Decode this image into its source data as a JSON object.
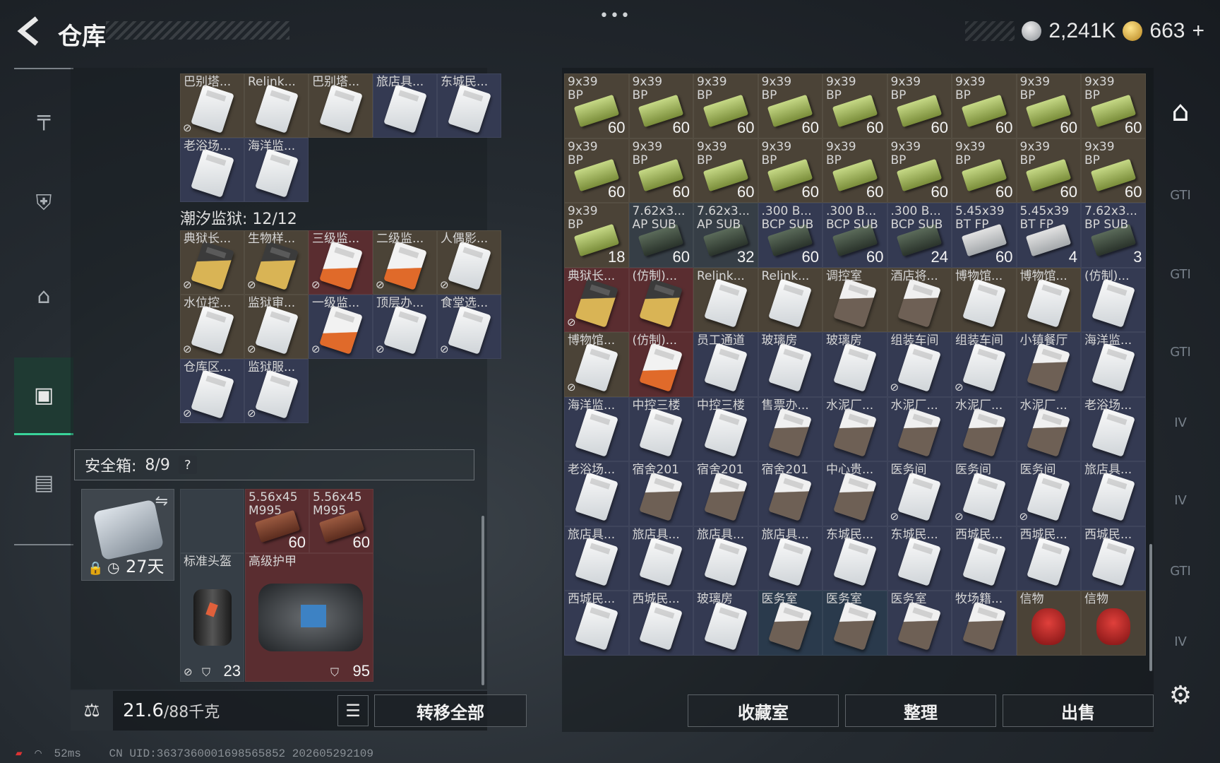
{
  "header": {
    "title": "仓库",
    "silver": "2,241K",
    "gold": "663",
    "plus": "+"
  },
  "left_nav": [
    "weapon-icon",
    "armor-icon",
    "backpack-icon",
    "container-icon",
    "toolbox-icon"
  ],
  "pouch_grid_top": [
    {
      "name": "巴别塔...",
      "color": "brown",
      "card": "white",
      "locked": true
    },
    {
      "name": "Relink...",
      "color": "brown",
      "card": "white",
      "locked": false
    },
    {
      "name": "巴别塔...",
      "color": "brown",
      "card": "white",
      "locked": false
    },
    {
      "name": "旅店具...",
      "color": "navy",
      "card": "white",
      "locked": false
    },
    {
      "name": "东城民...",
      "color": "navy",
      "card": "white",
      "locked": false
    },
    {
      "name": "老浴场...",
      "color": "navy",
      "card": "white",
      "locked": false
    },
    {
      "name": "海洋监...",
      "color": "navy",
      "card": "white",
      "locked": false
    }
  ],
  "prison_label": "潮汐监狱: 12/12",
  "prison_grid": [
    {
      "name": "典狱长...",
      "color": "brown",
      "card": "gold",
      "locked": true
    },
    {
      "name": "生物样...",
      "color": "brown",
      "card": "gold",
      "locked": true
    },
    {
      "name": "三级监...",
      "color": "red",
      "card": "orange",
      "locked": true
    },
    {
      "name": "二级监...",
      "color": "brown",
      "card": "orange",
      "locked": true
    },
    {
      "name": "人偶影...",
      "color": "brown",
      "card": "white",
      "locked": true
    },
    {
      "name": "水位控...",
      "color": "brown",
      "card": "white",
      "locked": true
    },
    {
      "name": "监狱审...",
      "color": "brown",
      "card": "white",
      "locked": true
    },
    {
      "name": "一级监...",
      "color": "navy",
      "card": "orange",
      "locked": true
    },
    {
      "name": "顶层办...",
      "color": "navy",
      "card": "white",
      "locked": true
    },
    {
      "name": "食堂选...",
      "color": "navy",
      "card": "white",
      "locked": true
    },
    {
      "name": "仓库区...",
      "color": "navy",
      "card": "white",
      "locked": true
    },
    {
      "name": "监狱服...",
      "color": "navy",
      "card": "white",
      "locked": true
    }
  ],
  "safe_box": {
    "label": "安全箱:",
    "count": "8/9",
    "help": "?",
    "days": "27天"
  },
  "safe_items": [
    {
      "name": "5.56x45\nM995",
      "count": "60"
    },
    {
      "name": "5.56x45\nM995",
      "count": "60"
    }
  ],
  "helmet": {
    "name": "标准头盔",
    "durability": "23"
  },
  "armor": {
    "name": "高级护甲",
    "durability": "95"
  },
  "weight": {
    "value": "21.6",
    "max": "/88千克"
  },
  "buttons": {
    "transfer_all": "转移全部",
    "collection": "收藏室",
    "organize": "整理",
    "sell": "出售"
  },
  "stash": [
    {
      "name": "9x39\nBP",
      "count": "60",
      "color": "brown",
      "type": "ammo"
    },
    {
      "name": "9x39\nBP",
      "count": "60",
      "color": "brown",
      "type": "ammo"
    },
    {
      "name": "9x39\nBP",
      "count": "60",
      "color": "brown",
      "type": "ammo"
    },
    {
      "name": "9x39\nBP",
      "count": "60",
      "color": "brown",
      "type": "ammo"
    },
    {
      "name": "9x39\nBP",
      "count": "60",
      "color": "brown",
      "type": "ammo"
    },
    {
      "name": "9x39\nBP",
      "count": "60",
      "color": "brown",
      "type": "ammo"
    },
    {
      "name": "9x39\nBP",
      "count": "60",
      "color": "brown",
      "type": "ammo"
    },
    {
      "name": "9x39\nBP",
      "count": "60",
      "color": "brown",
      "type": "ammo"
    },
    {
      "name": "9x39\nBP",
      "count": "60",
      "color": "brown",
      "type": "ammo"
    },
    {
      "name": "9x39\nBP",
      "count": "60",
      "color": "brown",
      "type": "ammo"
    },
    {
      "name": "9x39\nBP",
      "count": "60",
      "color": "brown",
      "type": "ammo"
    },
    {
      "name": "9x39\nBP",
      "count": "60",
      "color": "brown",
      "type": "ammo"
    },
    {
      "name": "9x39\nBP",
      "count": "60",
      "color": "brown",
      "type": "ammo"
    },
    {
      "name": "9x39\nBP",
      "count": "60",
      "color": "brown",
      "type": "ammo"
    },
    {
      "name": "9x39\nBP",
      "count": "60",
      "color": "brown",
      "type": "ammo"
    },
    {
      "name": "9x39\nBP",
      "count": "60",
      "color": "brown",
      "type": "ammo"
    },
    {
      "name": "9x39\nBP",
      "count": "60",
      "color": "brown",
      "type": "ammo"
    },
    {
      "name": "9x39\nBP",
      "count": "60",
      "color": "brown",
      "type": "ammo"
    },
    {
      "name": "9x39\nBP",
      "count": "18",
      "color": "brown",
      "type": "ammo"
    },
    {
      "name": "7.62x3...\nAP SUB",
      "count": "60",
      "color": "dark",
      "type": "ammo2"
    },
    {
      "name": "7.62x3...\nAP SUB",
      "count": "32",
      "color": "dark",
      "type": "ammo2"
    },
    {
      "name": ".300 B...\nBCP SUB",
      "count": "60",
      "color": "navy",
      "type": "ammo2"
    },
    {
      "name": ".300 B...\nBCP SUB",
      "count": "60",
      "color": "navy",
      "type": "ammo2"
    },
    {
      "name": ".300 B...\nBCP SUB",
      "count": "24",
      "color": "navy",
      "type": "ammo2"
    },
    {
      "name": "5.45x39\nBT FP",
      "count": "60",
      "color": "navy",
      "type": "ammo3"
    },
    {
      "name": "5.45x39\nBT FP",
      "count": "4",
      "color": "navy",
      "type": "ammo3"
    },
    {
      "name": "7.62x3...\nBP SUB",
      "count": "3",
      "color": "navy",
      "type": "ammo2"
    },
    {
      "name": "典狱长...",
      "count": "",
      "color": "red",
      "type": "card-gold",
      "locked": true
    },
    {
      "name": "(仿制)...",
      "count": "",
      "color": "red",
      "type": "card-gold"
    },
    {
      "name": "Relink...",
      "count": "",
      "color": "brown",
      "type": "card"
    },
    {
      "name": "Relink...",
      "count": "",
      "color": "brown",
      "type": "card"
    },
    {
      "name": "调控室",
      "count": "",
      "color": "brown",
      "type": "card-dirty"
    },
    {
      "name": "酒店将...",
      "count": "",
      "color": "brown",
      "type": "card-dirty"
    },
    {
      "name": "博物馆...",
      "count": "",
      "color": "brown",
      "type": "card"
    },
    {
      "name": "博物馆...",
      "count": "",
      "color": "brown",
      "type": "card"
    },
    {
      "name": "(仿制)...",
      "count": "",
      "color": "navy",
      "type": "card"
    },
    {
      "name": "博物馆...",
      "count": "",
      "color": "brown",
      "type": "card",
      "locked": true
    },
    {
      "name": "(仿制)...",
      "count": "",
      "color": "red",
      "type": "card-orange"
    },
    {
      "name": "员工通道",
      "count": "",
      "color": "navy",
      "type": "card"
    },
    {
      "name": "玻璃房",
      "count": "",
      "color": "navy",
      "type": "card"
    },
    {
      "name": "玻璃房",
      "count": "",
      "color": "navy",
      "type": "card"
    },
    {
      "name": "组装车间",
      "count": "",
      "color": "navy",
      "type": "card",
      "locked": true
    },
    {
      "name": "组装车间",
      "count": "",
      "color": "navy",
      "type": "card",
      "locked": true
    },
    {
      "name": "小镇餐厅",
      "count": "",
      "color": "navy",
      "type": "card-dirty"
    },
    {
      "name": "海洋监...",
      "count": "",
      "color": "navy",
      "type": "card"
    },
    {
      "name": "海洋监...",
      "count": "",
      "color": "navy",
      "type": "card"
    },
    {
      "name": "中控三楼",
      "count": "",
      "color": "navy",
      "type": "card"
    },
    {
      "name": "中控三楼",
      "count": "",
      "color": "navy",
      "type": "card"
    },
    {
      "name": "售票办...",
      "count": "",
      "color": "navy",
      "type": "card-dirty"
    },
    {
      "name": "水泥厂...",
      "count": "",
      "color": "navy",
      "type": "card-dirty"
    },
    {
      "name": "水泥厂...",
      "count": "",
      "color": "navy",
      "type": "card-dirty"
    },
    {
      "name": "水泥厂...",
      "count": "",
      "color": "navy",
      "type": "card-dirty"
    },
    {
      "name": "水泥厂...",
      "count": "",
      "color": "navy",
      "type": "card-dirty"
    },
    {
      "name": "老浴场...",
      "count": "",
      "color": "navy",
      "type": "card"
    },
    {
      "name": "老浴场...",
      "count": "",
      "color": "navy",
      "type": "card"
    },
    {
      "name": "宿舍201",
      "count": "",
      "color": "navy",
      "type": "card-dirty"
    },
    {
      "name": "宿舍201",
      "count": "",
      "color": "navy",
      "type": "card-dirty"
    },
    {
      "name": "宿舍201",
      "count": "",
      "color": "navy",
      "type": "card-dirty"
    },
    {
      "name": "中心贵...",
      "count": "",
      "color": "navy",
      "type": "card-dirty"
    },
    {
      "name": "医务间",
      "count": "",
      "color": "navy",
      "type": "card",
      "locked": true
    },
    {
      "name": "医务间",
      "count": "",
      "color": "navy",
      "type": "card",
      "locked": true
    },
    {
      "name": "医务间",
      "count": "",
      "color": "navy",
      "type": "card",
      "locked": true
    },
    {
      "name": "旅店具...",
      "count": "",
      "color": "navy",
      "type": "card"
    },
    {
      "name": "旅店具...",
      "count": "",
      "color": "navy",
      "type": "card"
    },
    {
      "name": "旅店具...",
      "count": "",
      "color": "navy",
      "type": "card"
    },
    {
      "name": "旅店具...",
      "count": "",
      "color": "navy",
      "type": "card"
    },
    {
      "name": "旅店具...",
      "count": "",
      "color": "navy",
      "type": "card"
    },
    {
      "name": "东城民...",
      "count": "",
      "color": "navy",
      "type": "card"
    },
    {
      "name": "东城民...",
      "count": "",
      "color": "navy",
      "type": "card"
    },
    {
      "name": "西城民...",
      "count": "",
      "color": "navy",
      "type": "card"
    },
    {
      "name": "西城民...",
      "count": "",
      "color": "navy",
      "type": "card"
    },
    {
      "name": "西城民...",
      "count": "",
      "color": "navy",
      "type": "card"
    },
    {
      "name": "西城民...",
      "count": "",
      "color": "navy",
      "type": "card"
    },
    {
      "name": "西城民...",
      "count": "",
      "color": "navy",
      "type": "card"
    },
    {
      "name": "玻璃房",
      "count": "",
      "color": "navy",
      "type": "card"
    },
    {
      "name": "医务室",
      "count": "",
      "color": "blue",
      "type": "card-dirty"
    },
    {
      "name": "医务室",
      "count": "",
      "color": "blue",
      "type": "card-dirty"
    },
    {
      "name": "医务室",
      "count": "",
      "color": "navy",
      "type": "card-dirty"
    },
    {
      "name": "牧场籍...",
      "count": "",
      "color": "navy",
      "type": "card-dirty"
    },
    {
      "name": "信物",
      "count": "",
      "color": "brown",
      "type": "mask"
    },
    {
      "name": "信物",
      "count": "",
      "color": "brown",
      "type": "mask"
    }
  ],
  "right_nav": [
    "home-icon",
    "GTI",
    "GTI",
    "GTI",
    "IV",
    "IV",
    "GTI",
    "IV"
  ],
  "footer": {
    "ping": "52ms",
    "uid": "CN UID:3637360001698565852 202605292109"
  }
}
